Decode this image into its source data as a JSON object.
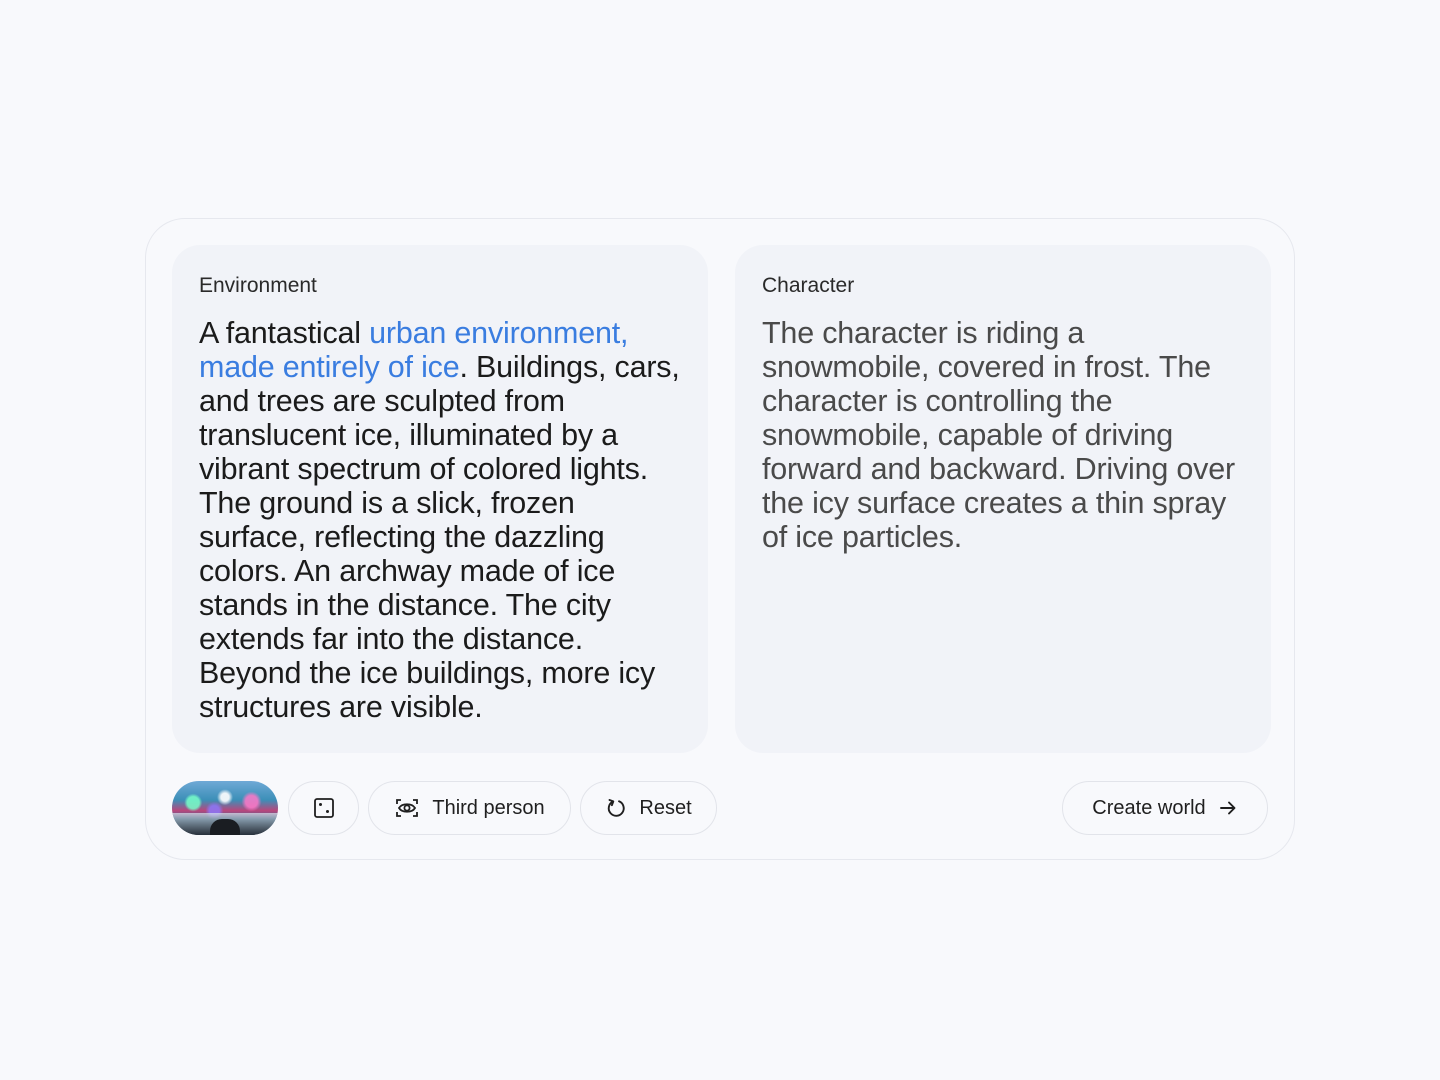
{
  "environment": {
    "title": "Environment",
    "text_before": "A fantastical ",
    "text_highlight": "urban environment, made entirely of ice",
    "text_after": ". Buildings, cars, and trees are sculpted from translucent ice, illuminated by a vibrant spectrum of colored lights. The ground is a slick, frozen surface, reflecting the dazzling colors. An archway made of ice stands in the distance. The city extends far into the distance. Beyond the ice buildings, more icy structures are visible."
  },
  "character": {
    "title": "Character",
    "text": "The character is riding a snowmobile, covered in frost. The character is controlling the snowmobile, capable of driving forward and backward. Driving over the icy surface creates a thin spray of ice particles."
  },
  "toolbar": {
    "thumbnail_icon": "preview-thumbnail",
    "random_icon": "dice-icon",
    "view_icon": "eye-view-icon",
    "view_label": "Third person",
    "reset_icon": "reset-icon",
    "reset_label": "Reset",
    "create_label": "Create world",
    "create_icon": "arrow-right-icon"
  },
  "colors": {
    "highlight": "#3a7de0",
    "background": "#f8f9fc",
    "panel": "#f1f3f8"
  }
}
